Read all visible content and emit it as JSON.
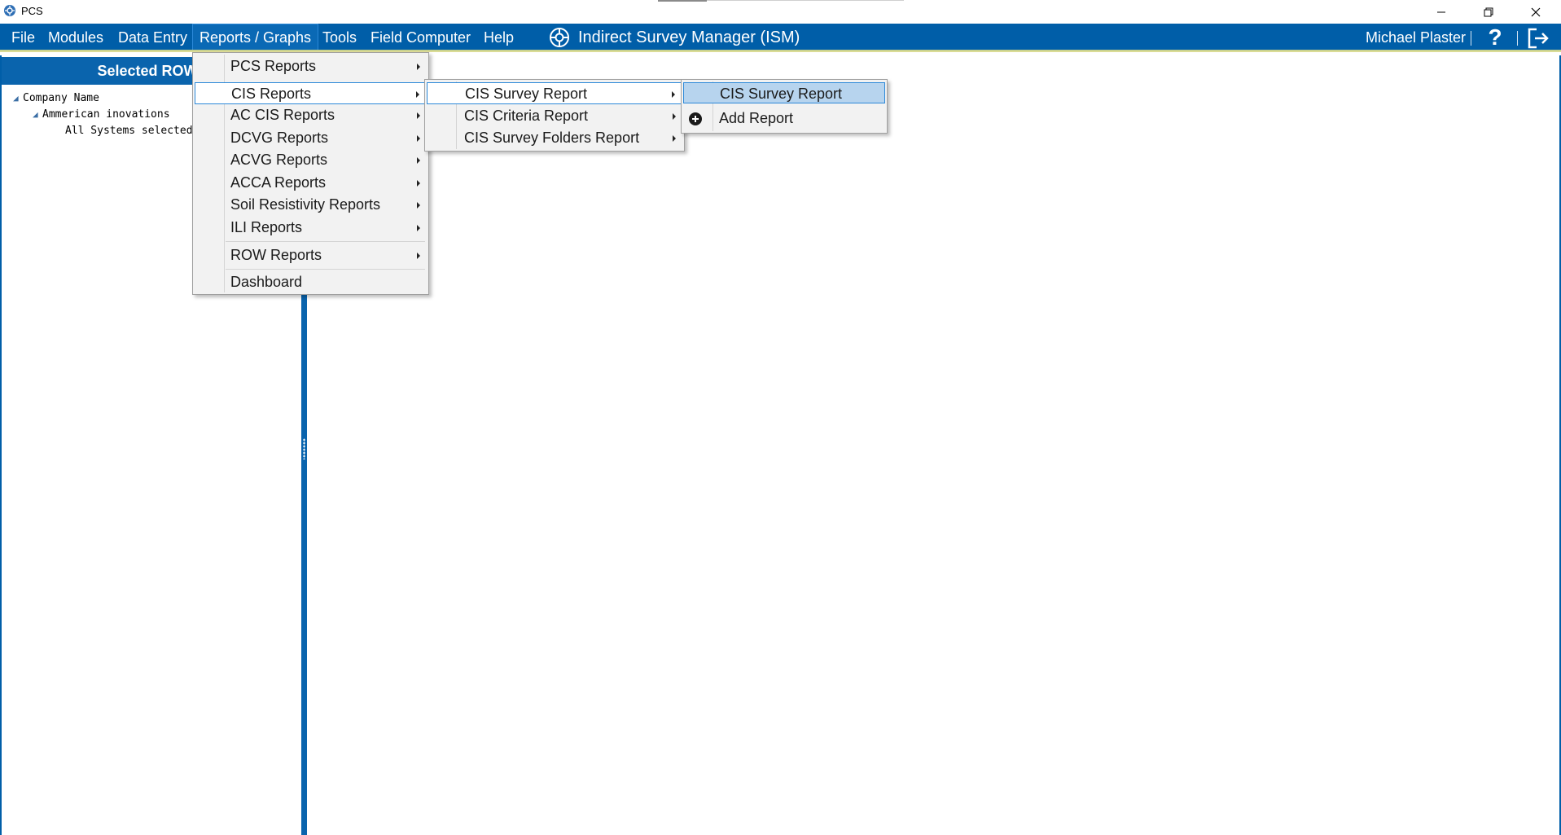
{
  "window": {
    "app_title": "PCS",
    "controls": {
      "minimize": "minimize",
      "restore": "restore",
      "close": "close"
    }
  },
  "menubar": {
    "items": [
      {
        "label": "File"
      },
      {
        "label": "Modules"
      },
      {
        "label": "Data Entry"
      },
      {
        "label": "Reports / Graphs"
      },
      {
        "label": "Tools"
      },
      {
        "label": "Field Computer"
      },
      {
        "label": "Help"
      }
    ],
    "banner_title": "Indirect Survey Manager (ISM)",
    "user_name": "Michael Plaster",
    "help_glyph": "?"
  },
  "left_panel": {
    "header": "Selected ROWs",
    "tree": [
      {
        "label": "Company Name",
        "level": 0
      },
      {
        "label": "Ammerican inovations",
        "level": 1
      },
      {
        "label": "All Systems selected",
        "level": 2
      }
    ]
  },
  "reports_menu": {
    "items": [
      {
        "label": "PCS Reports",
        "submenu": true
      },
      {
        "label": "CIS Reports",
        "submenu": true,
        "highlighted": true
      },
      {
        "label": "AC CIS Reports",
        "submenu": true
      },
      {
        "label": "DCVG Reports",
        "submenu": true
      },
      {
        "label": "ACVG Reports",
        "submenu": true
      },
      {
        "label": "ACCA Reports",
        "submenu": true
      },
      {
        "label": "Soil Resistivity Reports",
        "submenu": true
      },
      {
        "label": "ILI Reports",
        "submenu": true
      },
      {
        "label": "ROW Reports",
        "submenu": true
      },
      {
        "label": "Dashboard",
        "submenu": false
      }
    ]
  },
  "cis_menu": {
    "items": [
      {
        "label": "CIS Survey Report",
        "submenu": true,
        "highlighted": true
      },
      {
        "label": "CIS Criteria Report",
        "submenu": true
      },
      {
        "label": "CIS Survey Folders Report",
        "submenu": true
      }
    ]
  },
  "cis_survey_menu": {
    "items": [
      {
        "label": "CIS Survey Report",
        "selected": true
      },
      {
        "label": "Add Report",
        "icon": "add-circle-icon"
      }
    ]
  },
  "colors": {
    "menubar_bg": "#005ea8",
    "panel_header_bg": "#0a64ad",
    "highlight_border": "#2b88d8",
    "selected_bg": "#b7d4ee",
    "menu_bg": "#f2f2f2"
  }
}
